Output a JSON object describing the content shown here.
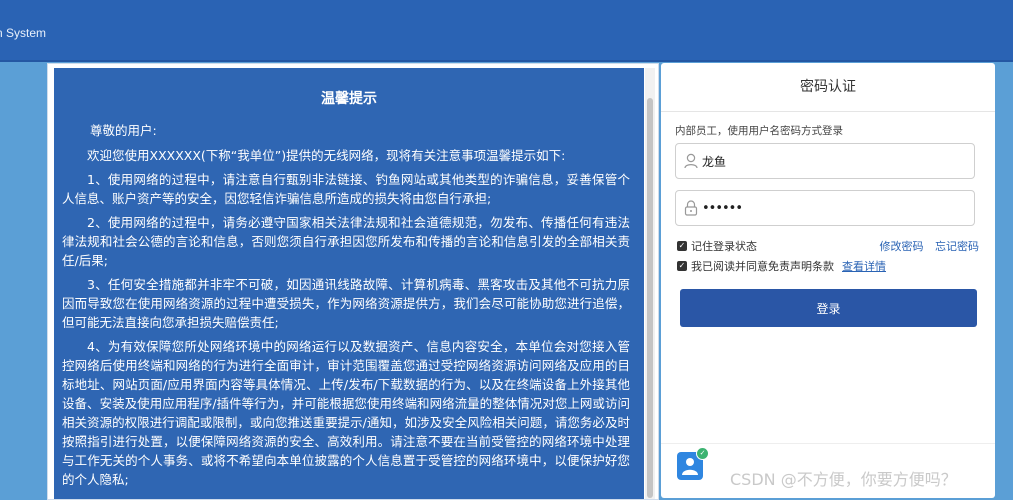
{
  "header": {
    "title": "n System"
  },
  "notice": {
    "title": "温馨提示",
    "greeting": "尊敬的用户:",
    "intro": "欢迎您使用XXXXXX(下称“我单位”)提供的无线网络，现将有关注意事项温馨提示如下:",
    "items": [
      "1、使用网络的过程中，请注意自行甄别非法链接、钓鱼网站或其他类型的诈骗信息，妥善保管个人信息、账户资产等的安全，因您轻信诈骗信息所造成的损失将由您自行承担;",
      "2、使用网络的过程中，请务必遵守国家相关法律法规和社会道德规范，勿发布、传播任何有违法律法规和社会公德的言论和信息，否则您须自行承担因您所发布和传播的言论和信息引发的全部相关责任/后果;",
      "3、任何安全措施都并非牢不可破，如因通讯线路故障、计算机病毒、黑客攻击及其他不可抗力原因而导致您在使用网络资源的过程中遭受损失，作为网络资源提供方，我们会尽可能协助您进行追偿，但可能无法直接向您承担损失赔偿责任;",
      "4、为有效保障您所处网络环境中的网络运行以及数据资产、信息内容安全，本单位会对您接入管控网络后使用终端和网络的行为进行全面审计，审计范围覆盖您通过受控网络资源访问网络及应用的目标地址、网站页面/应用界面内容等具体情况、上传/发布/下载数据的行为、以及在终端设备上外接其他设备、安装及使用应用程序/插件等行为，并可能根据您使用终端和网络流量的整体情况对您上网或访问相关资源的权限进行调配或限制，或向您推送重要提示/通知，如涉及安全风险相关问题，请您务必及时按照指引进行处置，以便保障网络资源的安全、高效利用。请注意不要在当前受管控的网络环境中处理与工作无关的个人事务、或将不希望向本单位披露的个人信息置于受管控的网络环境中，以便保护好您的个人隐私;"
    ]
  },
  "login": {
    "title": "密码认证",
    "hint": "内部员工，使用用户名密码方式登录",
    "username": "龙鱼",
    "password_mask": "••••••",
    "remember_label": "记住登录状态",
    "agree_label": "我已阅读并同意免责声明条款",
    "detail_link": "查看详情",
    "change_password": "修改密码",
    "forgot_password": "忘记密码",
    "submit_label": "登录"
  },
  "watermark": "CSDN @不方便，你要方便吗？",
  "colors": {
    "header": "#2a63b4",
    "notice_bg": "#2f66b3",
    "button": "#2a56a6",
    "page_bg": "#5b9fd6"
  }
}
